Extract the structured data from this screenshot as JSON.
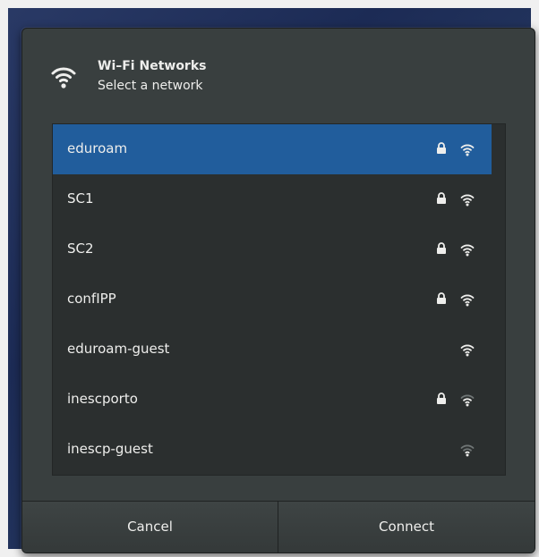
{
  "dialog": {
    "title": "Wi–Fi Networks",
    "subtitle": "Select a network",
    "header_icon": "wifi-icon"
  },
  "networks": [
    {
      "name": "eduroam",
      "secured": true,
      "signal": "strong",
      "selected": true
    },
    {
      "name": "SC1",
      "secured": true,
      "signal": "strong",
      "selected": false
    },
    {
      "name": "SC2",
      "secured": true,
      "signal": "strong",
      "selected": false
    },
    {
      "name": "confIPP",
      "secured": true,
      "signal": "strong",
      "selected": false
    },
    {
      "name": "eduroam-guest",
      "secured": false,
      "signal": "strong",
      "selected": false
    },
    {
      "name": "inescporto",
      "secured": true,
      "signal": "medium",
      "selected": false
    },
    {
      "name": "inescp-guest",
      "secured": false,
      "signal": "weak",
      "selected": false
    }
  ],
  "buttons": {
    "cancel": "Cancel",
    "connect": "Connect"
  },
  "colors": {
    "selection": "#215d9c",
    "dialog_bg": "#393f3f",
    "list_bg": "#2b2f2f",
    "text": "#eeeeec"
  }
}
